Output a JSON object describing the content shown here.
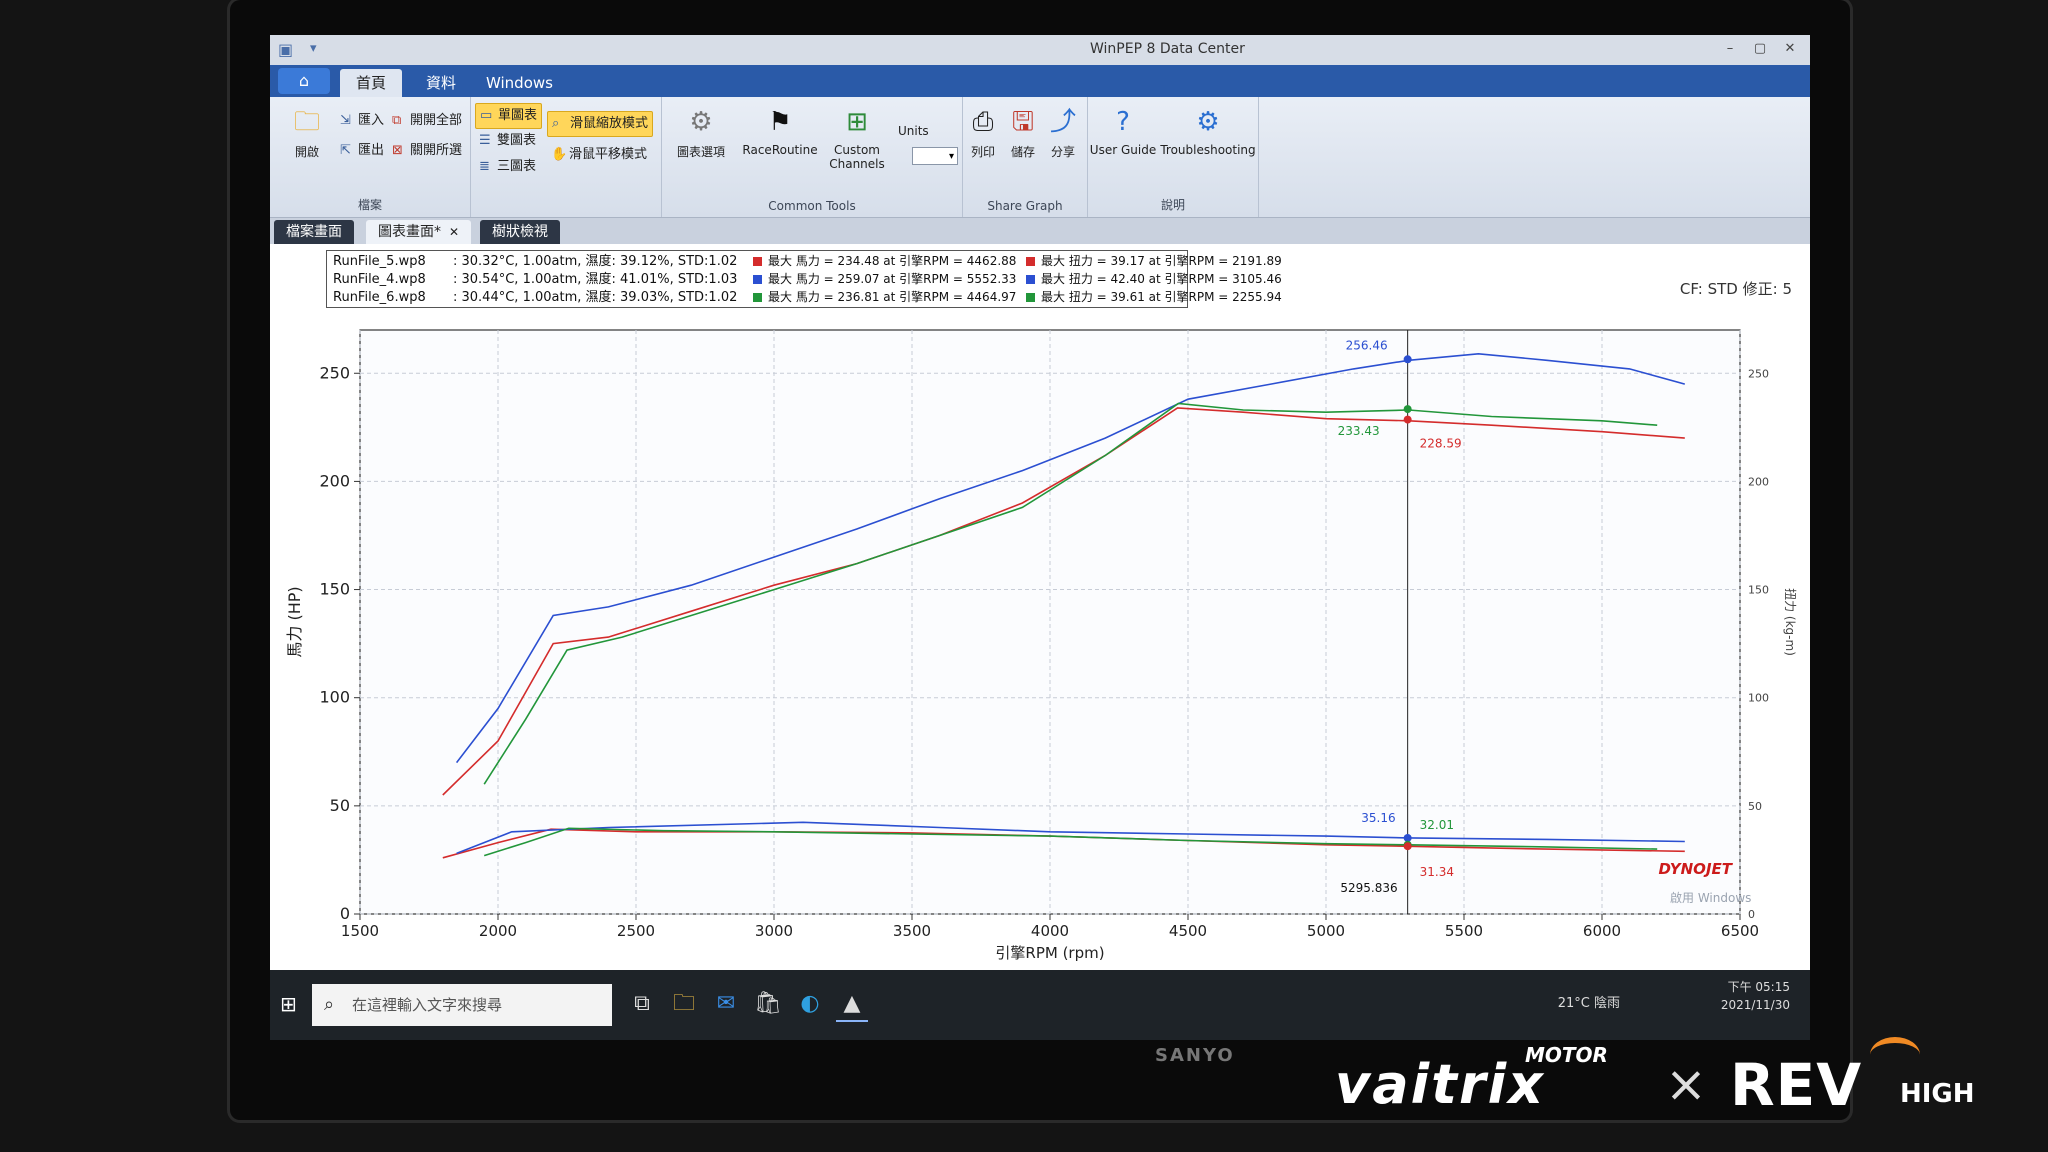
{
  "window": {
    "title": "WinPEP 8 Data Center"
  },
  "ribbon_tabs": [
    "首頁",
    "資料",
    "Windows"
  ],
  "ribbon": {
    "file_group": {
      "open_label": "開啟",
      "import_label": "匯入",
      "export_label": "匯出",
      "open_all_label": "開開全部",
      "close_all_label": "關開所選",
      "group_label": "檔案"
    },
    "view_group": {
      "single_label": "單圖表",
      "dual_label": "雙圖表",
      "triple_label": "三圖表",
      "zoom_mode_label": "滑鼠縮放模式",
      "pan_mode_label": "滑鼠平移模式"
    },
    "tools_group": {
      "graph_options_label": "圖表選項",
      "race_routine_label": "RaceRoutine",
      "custom_channels_label": "Custom Channels",
      "units_label": "Units",
      "group_label": "Common Tools"
    },
    "share_group": {
      "print_label": "列印",
      "save_label": "儲存",
      "share_label": "分享",
      "group_label": "Share Graph"
    },
    "help_group": {
      "user_guide_label": "User Guide",
      "troubleshooting_label": "Troubleshooting",
      "group_label": "說明"
    }
  },
  "doc_tabs": [
    "檔案畫面",
    "圖表畫面*",
    "樹狀檢視"
  ],
  "legend": {
    "rows": [
      {
        "file": "RunFile_5.wp8",
        "conditions": ": 30.32°C, 1.00atm, 濕度: 39.12%, STD:1.02",
        "color": "#d42c2c",
        "peak_power": "最大 馬力 = 234.48 at 引擎RPM = 4462.88",
        "peak_torque": "最大 扭力 = 39.17 at 引擎RPM = 2191.89"
      },
      {
        "file": "RunFile_4.wp8",
        "conditions": ": 30.54°C, 1.00atm, 濕度: 41.01%, STD:1.03",
        "color": "#2b4fd1",
        "peak_power": "最大 馬力 = 259.07 at 引擎RPM = 5552.33",
        "peak_torque": "最大 扭力 = 42.40 at 引擎RPM = 3105.46"
      },
      {
        "file": "RunFile_6.wp8",
        "conditions": ": 30.44°C, 1.00atm, 濕度: 39.03%, STD:1.02",
        "color": "#22963a",
        "peak_power": "最大 馬力 = 236.81 at 引擎RPM = 4464.97",
        "peak_torque": "最大 扭力 = 39.61 at 引擎RPM = 2255.94"
      }
    ],
    "cf_text": "CF: STD 修正: 5"
  },
  "chart_data": {
    "type": "line",
    "xlabel": "引擎RPM (rpm)",
    "ylabel": "馬力 (HP)",
    "y2label": "扭力 (kg-m)",
    "xlim": [
      1500,
      6500
    ],
    "ylim": [
      0,
      270
    ],
    "y2lim": [
      0,
      270
    ],
    "x_ticks": [
      1500,
      2000,
      2500,
      3000,
      3500,
      4000,
      4500,
      5000,
      5500,
      6000,
      6500
    ],
    "y_ticks": [
      0,
      50,
      100,
      150,
      200,
      250
    ],
    "y2_ticks_labels": [
      "0",
      "50",
      "100",
      "150",
      "200",
      "250"
    ],
    "grid": true,
    "cursor_rpm": 5295.836,
    "cursor_rpm_label": "5295.836",
    "cursor_readouts": {
      "power": [
        {
          "series": "RunFile_4.wp8",
          "value": 256.46,
          "label": "256.46",
          "color": "#2b4fd1"
        },
        {
          "series": "RunFile_6.wp8",
          "value": 233.43,
          "label": "233.43",
          "color": "#22963a"
        },
        {
          "series": "RunFile_5.wp8",
          "value": 228.59,
          "label": "228.59",
          "color": "#d42c2c"
        }
      ],
      "torque": [
        {
          "series": "RunFile_4.wp8",
          "value": 35.16,
          "label": "35.16",
          "color": "#2b4fd1"
        },
        {
          "series": "RunFile_6.wp8",
          "value": 32.01,
          "label": "32.01",
          "color": "#22963a"
        },
        {
          "series": "RunFile_5.wp8",
          "value": 31.34,
          "label": "31.34",
          "color": "#d42c2c"
        }
      ]
    },
    "series": [
      {
        "name": "RunFile_5.wp8",
        "kind": "power",
        "color": "#d42c2c",
        "x": [
          1800,
          2000,
          2200,
          2400,
          2700,
          3000,
          3300,
          3600,
          3900,
          4200,
          4462,
          4700,
          5000,
          5300,
          5600,
          6000,
          6300
        ],
        "y": [
          55,
          80,
          125,
          128,
          140,
          152,
          162,
          175,
          190,
          212,
          234,
          232,
          229,
          228,
          226,
          223,
          220
        ]
      },
      {
        "name": "RunFile_4.wp8",
        "kind": "power",
        "color": "#2b4fd1",
        "x": [
          1850,
          2000,
          2200,
          2400,
          2700,
          3000,
          3300,
          3600,
          3900,
          4200,
          4500,
          4800,
          5100,
          5300,
          5552,
          5800,
          6100,
          6300
        ],
        "y": [
          70,
          95,
          138,
          142,
          152,
          165,
          178,
          192,
          205,
          220,
          238,
          245,
          252,
          256,
          259,
          256,
          252,
          245
        ]
      },
      {
        "name": "RunFile_6.wp8",
        "kind": "power",
        "color": "#22963a",
        "x": [
          1950,
          2100,
          2250,
          2450,
          2700,
          3000,
          3300,
          3600,
          3900,
          4200,
          4465,
          4700,
          5000,
          5300,
          5600,
          6000,
          6200
        ],
        "y": [
          60,
          90,
          122,
          128,
          138,
          150,
          162,
          175,
          188,
          212,
          236,
          233,
          232,
          233,
          230,
          228,
          226
        ]
      },
      {
        "name": "RunFile_5.wp8",
        "kind": "torque",
        "color": "#d42c2c",
        "x": [
          1800,
          2000,
          2192,
          2500,
          3000,
          3500,
          4000,
          4500,
          5000,
          5300,
          5800,
          6300
        ],
        "y": [
          26,
          33,
          39.2,
          38,
          38,
          37.5,
          36,
          34,
          32,
          31.3,
          30,
          29
        ]
      },
      {
        "name": "RunFile_4.wp8",
        "kind": "torque",
        "color": "#2b4fd1",
        "x": [
          1850,
          2050,
          2400,
          3105,
          3600,
          4000,
          4500,
          5000,
          5300,
          5800,
          6300
        ],
        "y": [
          28,
          38,
          40,
          42.4,
          40,
          38,
          37,
          36,
          35.2,
          34.5,
          33.5
        ]
      },
      {
        "name": "RunFile_6.wp8",
        "kind": "torque",
        "color": "#22963a",
        "x": [
          1950,
          2100,
          2256,
          2600,
          3000,
          3500,
          4000,
          4500,
          5000,
          5300,
          5800,
          6200
        ],
        "y": [
          27,
          33,
          39.6,
          38.5,
          38,
          37,
          36,
          34,
          32.5,
          32,
          31,
          30
        ]
      }
    ]
  },
  "watermark": "DYNOJET",
  "watermark_windows": "啟用 Windows",
  "taskbar": {
    "search_placeholder": "在這裡輸入文字來搜尋",
    "weather": "21°C 陰雨",
    "time": "下午 05:15",
    "date": "2021/11/30"
  },
  "overlay_brand": {
    "left_word": "vaitrix",
    "left_sub": "MOTOR",
    "separator": "×",
    "right_word": "REV",
    "right_sub": "HIGH"
  },
  "monitor_brand": "SANYO"
}
